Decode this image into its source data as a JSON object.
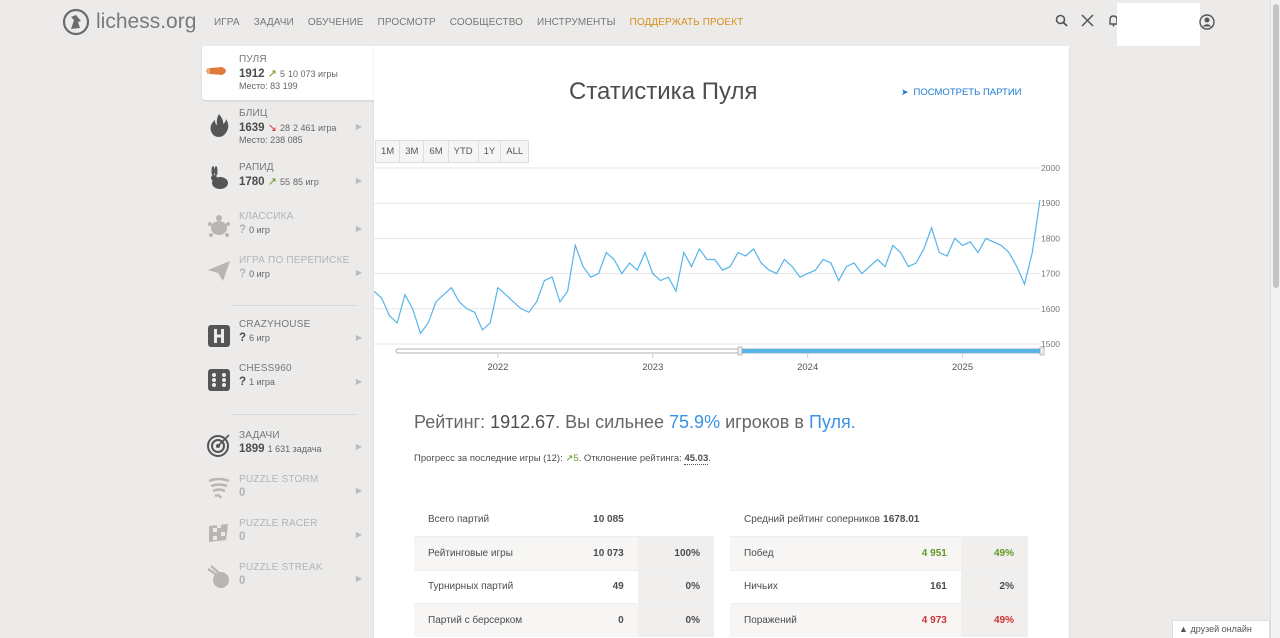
{
  "header": {
    "logo_text": "lichess.org",
    "nav": [
      "ИГРА",
      "ЗАДАЧИ",
      "ОБУЧЕНИЕ",
      "ПРОСМОТР",
      "СООБЩЕСТВО",
      "ИНСТРУМЕНТЫ"
    ],
    "donate": "ПОДДЕРЖАТЬ ПРОЕКТ",
    "icons": [
      "search-icon",
      "swords-icon",
      "bell-icon",
      "user-icon"
    ]
  },
  "sidebar": {
    "items": [
      {
        "name": "ПУЛЯ",
        "rating": "1912",
        "trend": "up",
        "delta": "5",
        "games": "10 073 игры",
        "rank": "Место: 83 199",
        "icon": "bullet-icon",
        "active": true
      },
      {
        "name": "БЛИЦ",
        "rating": "1639",
        "trend": "down",
        "delta": "28",
        "games": "2 461 игра",
        "rank": "Место: 238 085",
        "icon": "fire-icon"
      },
      {
        "name": "РАПИД",
        "rating": "1780",
        "trend": "up",
        "delta": "55",
        "games": "85 игр",
        "icon": "rabbit-icon"
      },
      {
        "name": "КЛАССИКА",
        "rating": "?",
        "games": "0 игр",
        "icon": "turtle-icon",
        "muted": true
      },
      {
        "name": "ИГРА ПО ПЕРЕПИСКЕ",
        "rating": "?",
        "games": "0 игр",
        "icon": "paper-plane-icon",
        "muted": true
      },
      {
        "name": "CRAZYHOUSE",
        "rating": "?",
        "games": "6 игр",
        "icon": "crazyhouse-icon"
      },
      {
        "name": "CHESS960",
        "rating": "?",
        "games": "1 игра",
        "icon": "dice-icon"
      },
      {
        "name": "ЗАДАЧИ",
        "rating": "1899",
        "games": "1 631 задача",
        "icon": "target-icon"
      },
      {
        "name": "PUZZLE STORM",
        "rating": "0",
        "icon": "storm-icon",
        "muted": true
      },
      {
        "name": "PUZZLE RACER",
        "rating": "0",
        "icon": "racer-flag-icon",
        "muted": true
      },
      {
        "name": "PUZZLE STREAK",
        "rating": "0",
        "icon": "streak-icon",
        "muted": true
      }
    ]
  },
  "main": {
    "title": "Статистика Пуля",
    "games_link": "ПОСМОТРЕТЬ ПАРТИИ",
    "ranges": [
      "1M",
      "3M",
      "6M",
      "YTD",
      "1Y",
      "ALL"
    ],
    "rating_prefix": "Рейтинг: ",
    "rating_value": "1912.67",
    "rating_mid": ". Вы сильнее ",
    "percentile": "75.9%",
    "rating_mid2": " игроков в ",
    "perf_name": "Пуля.",
    "progress_text": "Прогресс за последние игры (12): ",
    "progress_value": "5",
    "deviation_text": ". Отклонение рейтинга: ",
    "deviation_value": "45.03",
    "deviation_end": ".",
    "left_table": [
      {
        "label": "Всего партий",
        "value": "10 085",
        "pct": ""
      },
      {
        "label": "Рейтинговые игры",
        "value": "10 073",
        "pct": "100%"
      },
      {
        "label": "Турнирных партий",
        "value": "49",
        "pct": "0%"
      },
      {
        "label": "Партий с берсерком",
        "value": "0",
        "pct": "0%"
      }
    ],
    "right_table": [
      {
        "label": "Средний рейтинг соперников",
        "value": "1678.01",
        "pct": "",
        "color": ""
      },
      {
        "label": "Побед",
        "value": "4 951",
        "pct": "49%",
        "color": "green"
      },
      {
        "label": "Ничьих",
        "value": "161",
        "pct": "2%",
        "color": ""
      },
      {
        "label": "Поражений",
        "value": "4 973",
        "pct": "49%",
        "color": "red"
      }
    ]
  },
  "friends": "друзей онлайн",
  "colors": {
    "accent": "#3893e8",
    "donate": "#d59120",
    "up": "#629924",
    "down": "#cc3333",
    "line": "#56b4e9"
  },
  "chart_data": {
    "type": "line",
    "x_ticks": [
      "2022",
      "2023",
      "2024",
      "2025"
    ],
    "y_ticks": [
      "2000",
      "1900",
      "1800",
      "1700",
      "1600",
      "1500"
    ],
    "ylim": [
      1500,
      2000
    ],
    "x_range": [
      2021.2,
      2025.5
    ],
    "series": [
      {
        "x": [
          2021.2,
          2021.25,
          2021.3,
          2021.35,
          2021.4,
          2021.45,
          2021.5,
          2021.55,
          2021.6,
          2021.65,
          2021.7,
          2021.75,
          2021.8,
          2021.85,
          2021.9,
          2021.95,
          2022.0,
          2022.05,
          2022.1,
          2022.15,
          2022.2,
          2022.25,
          2022.3,
          2022.35,
          2022.4,
          2022.45,
          2022.5,
          2022.55,
          2022.6,
          2022.65,
          2022.7,
          2022.75,
          2022.8,
          2022.85,
          2022.9,
          2022.95,
          2023.0,
          2023.05,
          2023.1,
          2023.15,
          2023.2,
          2023.25,
          2023.3,
          2023.35,
          2023.4,
          2023.45,
          2023.5,
          2023.55,
          2023.6,
          2023.65,
          2023.7,
          2023.75,
          2023.8,
          2023.85,
          2023.9,
          2023.95,
          2024.0,
          2024.05,
          2024.1,
          2024.15,
          2024.2,
          2024.25,
          2024.3,
          2024.35,
          2024.4,
          2024.45,
          2024.5,
          2024.55,
          2024.6,
          2024.65,
          2024.7,
          2024.75,
          2024.8,
          2024.85,
          2024.9,
          2024.95,
          2025.0,
          2025.05,
          2025.1,
          2025.15,
          2025.2,
          2025.25,
          2025.3,
          2025.35,
          2025.4,
          2025.45,
          2025.5
        ],
        "y": [
          1650,
          1630,
          1580,
          1560,
          1640,
          1600,
          1530,
          1560,
          1620,
          1640,
          1660,
          1620,
          1600,
          1590,
          1540,
          1560,
          1660,
          1640,
          1620,
          1600,
          1590,
          1620,
          1680,
          1690,
          1620,
          1650,
          1780,
          1720,
          1690,
          1700,
          1760,
          1740,
          1700,
          1730,
          1710,
          1760,
          1700,
          1680,
          1690,
          1650,
          1760,
          1720,
          1770,
          1740,
          1740,
          1710,
          1720,
          1760,
          1750,
          1770,
          1730,
          1710,
          1700,
          1740,
          1720,
          1690,
          1700,
          1710,
          1740,
          1730,
          1680,
          1720,
          1730,
          1700,
          1720,
          1740,
          1720,
          1780,
          1760,
          1720,
          1730,
          1770,
          1830,
          1760,
          1750,
          1800,
          1780,
          1790,
          1760,
          1800,
          1790,
          1780,
          1760,
          1720,
          1670,
          1760,
          1910
        ]
      }
    ]
  }
}
